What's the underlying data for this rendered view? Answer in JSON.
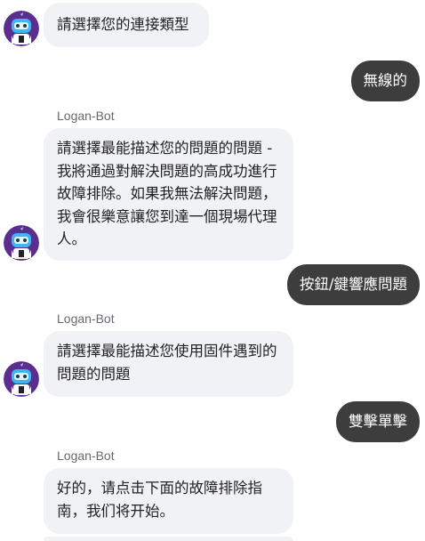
{
  "conversation": {
    "messages": [
      {
        "role": "bot",
        "text": "請選擇您的連接類型"
      },
      {
        "role": "user",
        "text": "無線的"
      },
      {
        "role": "bot",
        "sender": "Logan-Bot",
        "text": "請選擇最能描述您的問題的問題 - 我將通過對解決問題的高成功進行故障排除。如果我無法解決問題，我會很樂意讓您到達一個現場代理人。"
      },
      {
        "role": "user",
        "text": "按鈕/鍵響應問題"
      },
      {
        "role": "bot",
        "sender": "Logan-Bot",
        "text": "請選擇最能描述您使用固件遇到的問題的問題"
      },
      {
        "role": "user",
        "text": "雙擊單擊"
      },
      {
        "role": "bot",
        "sender": "Logan-Bot",
        "text": "好的，请点击下面的故障排除指南，我们将开始。"
      }
    ]
  },
  "avatar_icon": "robot-icon",
  "colors": {
    "bot_bubble": "#f1f2f5",
    "user_bubble": "#3d3d3d",
    "user_text": "#ffffff",
    "sender_text": "#666a70"
  }
}
